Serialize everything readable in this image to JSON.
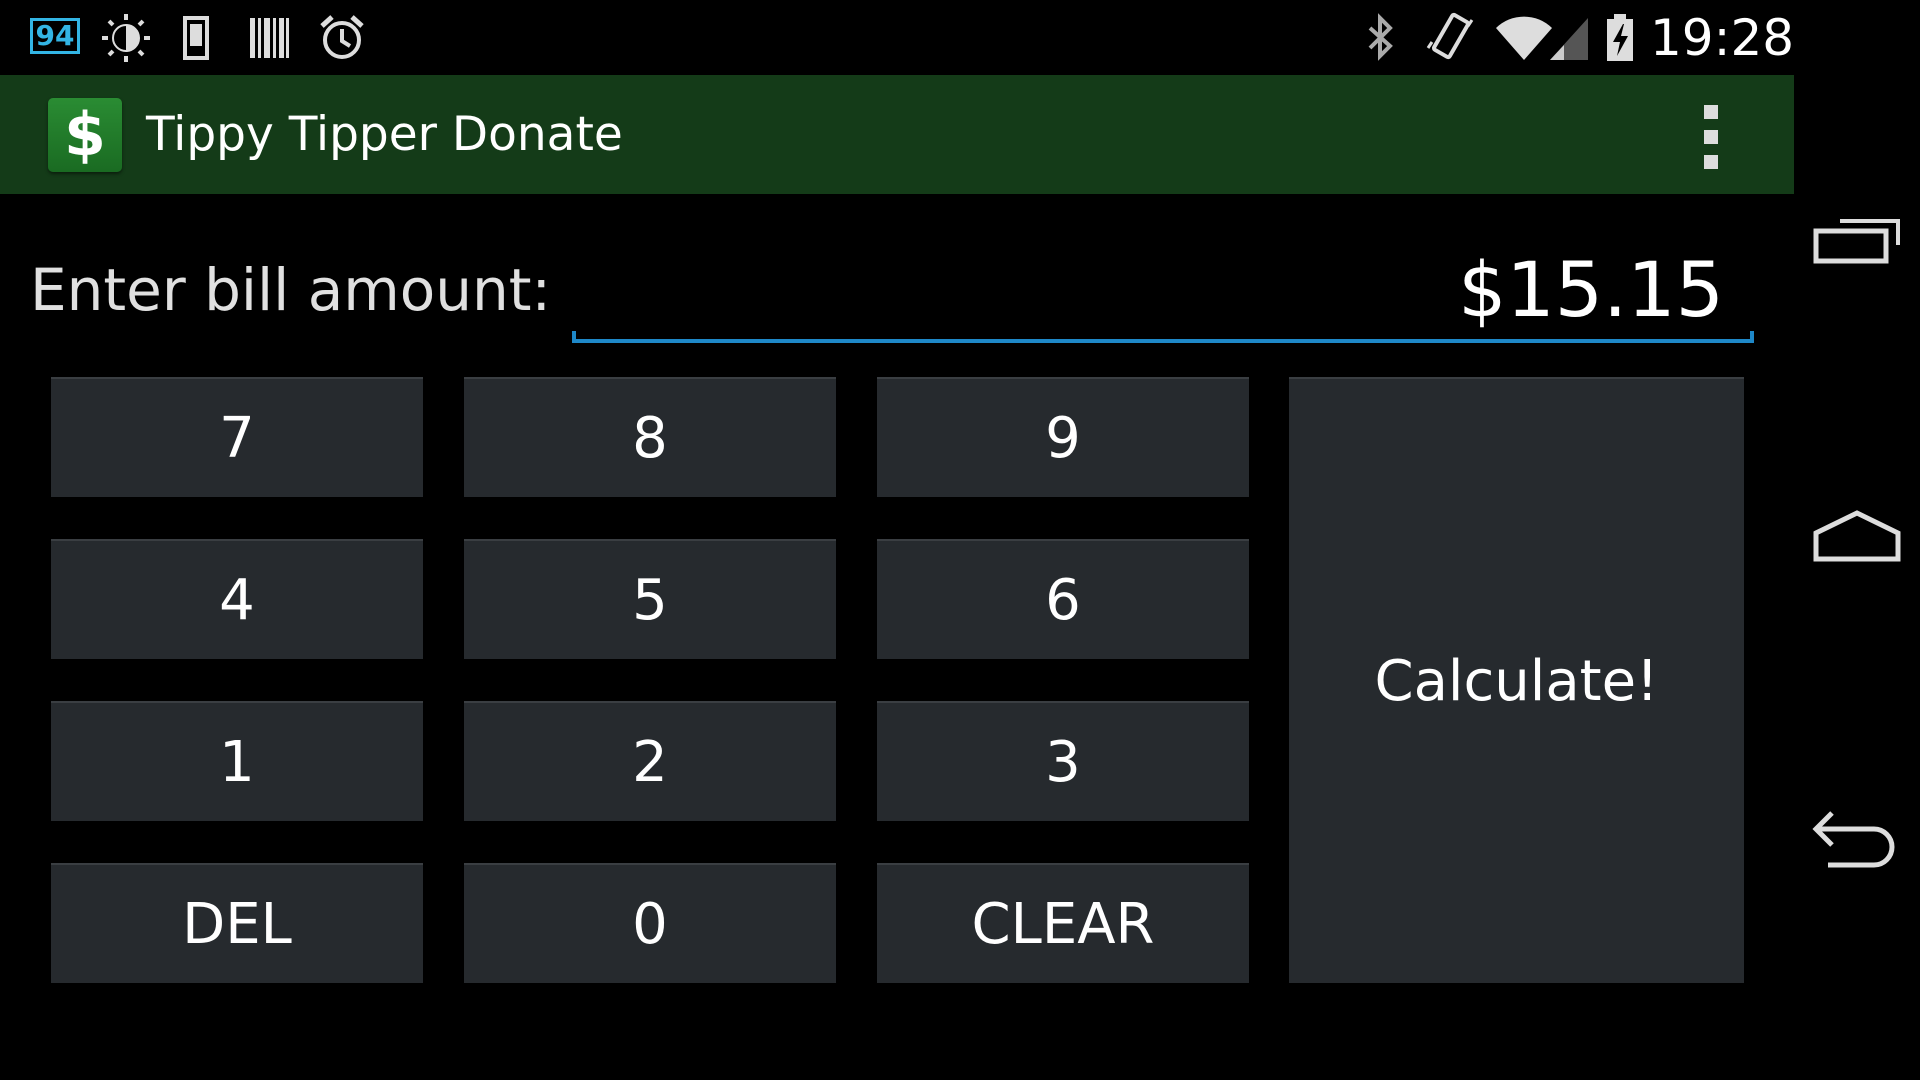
{
  "status_bar": {
    "battery_percent": "94",
    "time": "19:28",
    "icons": [
      "brightness-icon",
      "device-icon",
      "barcode-icon",
      "alarm-icon",
      "bluetooth-icon",
      "vibrate-icon",
      "wifi-icon",
      "signal-icon",
      "battery-charging-icon"
    ]
  },
  "action_bar": {
    "icon_glyph": "$",
    "title": "Tippy Tipper Donate",
    "background": "#143b18"
  },
  "bill": {
    "label": "Enter bill amount:",
    "value": "$15.15",
    "underline_color": "#1e88c8"
  },
  "keypad": {
    "keys": [
      "7",
      "8",
      "9",
      "4",
      "5",
      "6",
      "1",
      "2",
      "3",
      "DEL",
      "0",
      "CLEAR"
    ],
    "calculate_label": "Calculate!"
  },
  "nav_bar": {
    "buttons": [
      "recent-apps-icon",
      "home-icon",
      "back-icon"
    ]
  }
}
